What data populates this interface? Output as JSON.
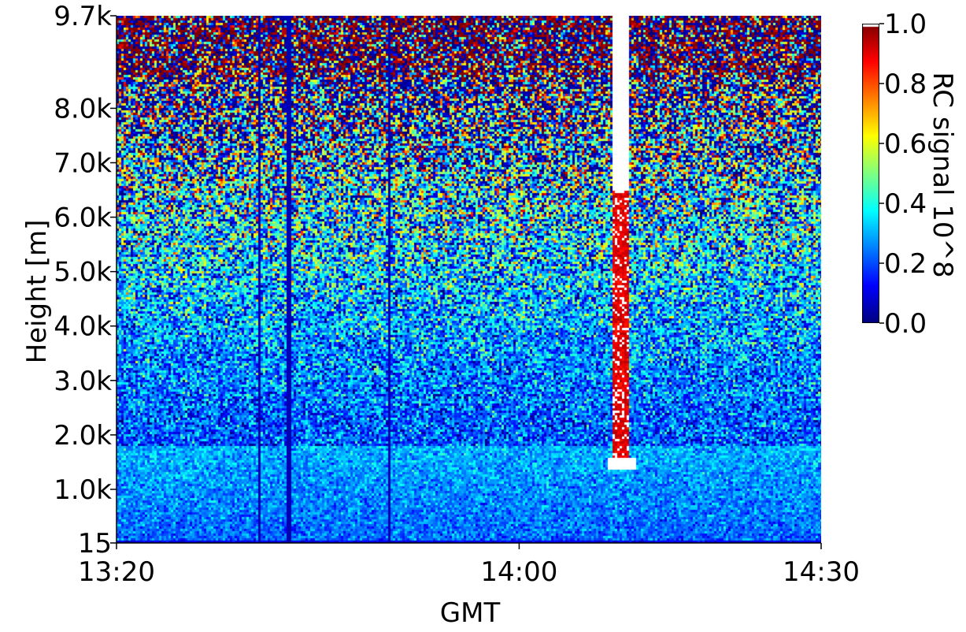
{
  "chart_data": {
    "type": "heatmap",
    "title": "",
    "xlabel": "GMT",
    "ylabel": "Height [m]",
    "x_ticks": [
      "13:20",
      "14:00",
      "14:30"
    ],
    "x_range": [
      "13:20",
      "14:30"
    ],
    "y_ticks": [
      "15",
      "1.0k",
      "2.0k",
      "3.0k",
      "4.0k",
      "5.0k",
      "6.0k",
      "7.0k",
      "8.0k",
      "9.7k"
    ],
    "y_range": [
      15,
      9700
    ],
    "colorbar": {
      "label": "RC signal 10^8",
      "ticks": [
        "0.0",
        "0.2",
        "0.4",
        "0.6",
        "0.8",
        "1.0"
      ],
      "range": [
        0.0,
        1.0
      ],
      "colormap": "jet"
    },
    "features": {
      "boundary_layer_top_m": 1800,
      "cloud_column_time": "14:10",
      "low_signal_times": [
        "13:34",
        "13:37",
        "13:47"
      ]
    }
  },
  "colors": {
    "low": "#00008f",
    "mid": "#00ff80",
    "high": "#8f0000",
    "saturated": "#ffffff"
  }
}
